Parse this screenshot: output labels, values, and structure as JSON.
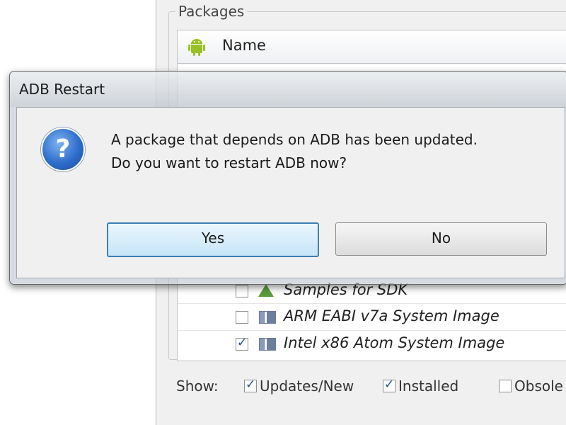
{
  "background": {
    "group_title": "Packages",
    "column_name": "Name",
    "rows": [
      {
        "label": "Samples for SDK",
        "checked": false,
        "icon": "flask-icon"
      },
      {
        "label": "ARM EABI v7a System Image",
        "checked": false,
        "icon": "system-image-icon"
      },
      {
        "label": "Intel x86 Atom System Image",
        "checked": true,
        "icon": "system-image-icon"
      }
    ],
    "show_label": "Show:",
    "show_options": [
      {
        "label": "Updates/New",
        "checked": true
      },
      {
        "label": "Installed",
        "checked": true
      },
      {
        "label": "Obsole",
        "checked": false
      }
    ]
  },
  "dialog": {
    "title": "ADB Restart",
    "message_line1": "A package that depends on ADB has been updated.",
    "message_line2": "Do you want to restart ADB now?",
    "yes_label": "Yes",
    "no_label": "No",
    "icon": "question-icon"
  },
  "colors": {
    "accent": "#3c7fb1",
    "question_blue": "#2e6dcb",
    "android_green": "#97c024"
  }
}
